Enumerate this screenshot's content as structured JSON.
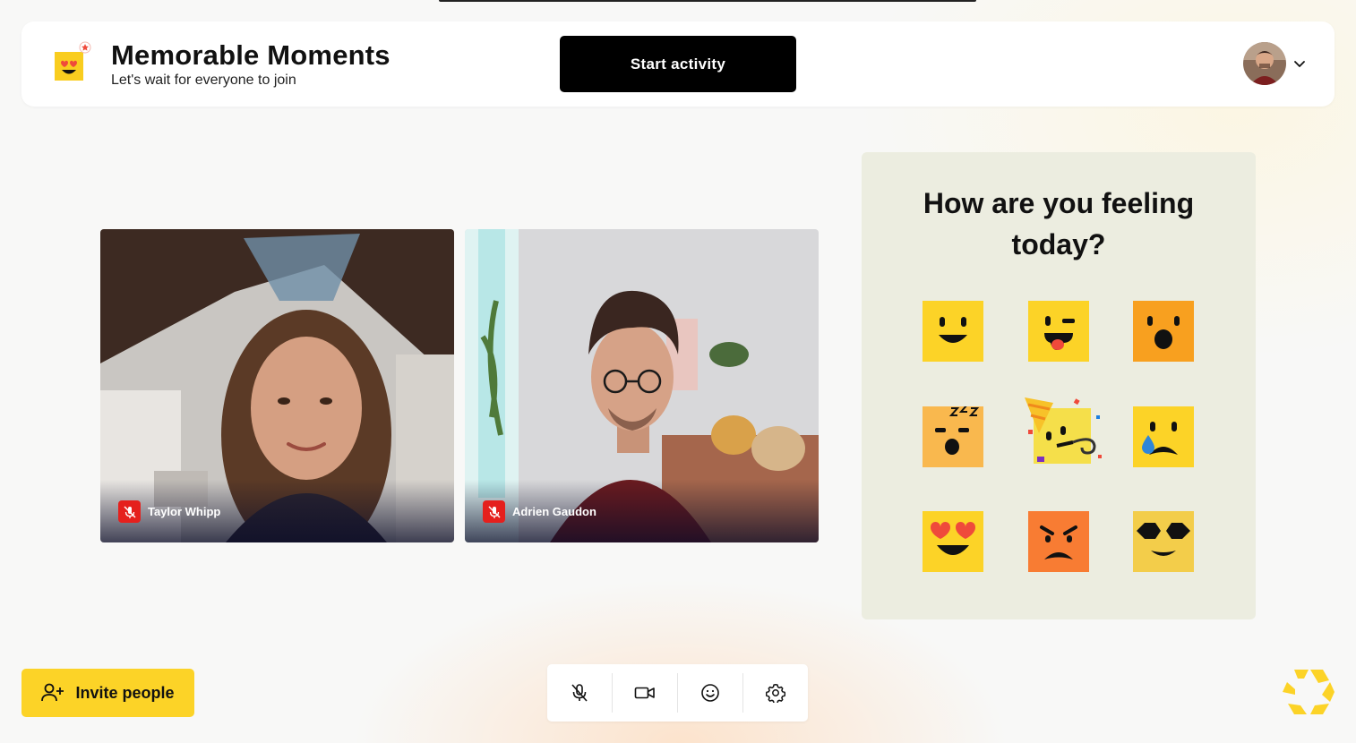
{
  "header": {
    "title": "Memorable Moments",
    "subtitle": "Let's wait for everyone to join",
    "start_button": "Start activity",
    "profile_icon": "chevron-down-icon"
  },
  "participants": [
    {
      "name": "Taylor Whipp",
      "muted": true
    },
    {
      "name": "Adrien Gaudon",
      "muted": true
    }
  ],
  "feeling_panel": {
    "question": "How are you feeling today?",
    "emojis": [
      "happy",
      "tongue-wink",
      "surprised",
      "sleepy",
      "party",
      "sad-tear",
      "heart-eyes",
      "angry",
      "cool-sunglasses"
    ]
  },
  "footer": {
    "invite_button": "Invite people",
    "controls": [
      "mic-off-icon",
      "video-camera-icon",
      "emoji-icon",
      "settings-gear-icon"
    ]
  },
  "colors": {
    "accent_yellow": "#fcd327",
    "mute_red": "#e5201d",
    "panel_bg": "#ecede0"
  }
}
